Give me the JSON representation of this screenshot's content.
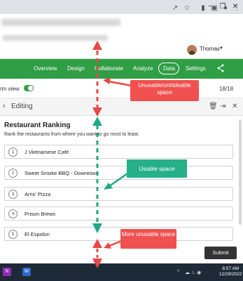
{
  "profile": {
    "name": "Thomas"
  },
  "nav": {
    "items": [
      "Overview",
      "Design",
      "Collaborate",
      "Analyze",
      "Data",
      "Settings"
    ],
    "active": "Data"
  },
  "form": {
    "view_label": "rm view",
    "count": "18/18"
  },
  "editing": {
    "title": "Editing"
  },
  "question": {
    "title": "Restaurant Ranking",
    "description": "Rank the restaurants from where you want to go most to least.",
    "items": [
      {
        "rank": "1",
        "label": "J Vietnamese Café"
      },
      {
        "rank": "2",
        "label": "Sweet Smoke BBQ - Downtown"
      },
      {
        "rank": "3",
        "label": "Arris' Pizza"
      },
      {
        "rank": "4",
        "label": "Prison Brews"
      },
      {
        "rank": "5",
        "label": "El Espolon"
      }
    ]
  },
  "footer": {
    "submit_label": "Submit"
  },
  "taskbar": {
    "time": "8:57 AM",
    "date": "12/29/2022",
    "app1_label": "N",
    "app2_label": "W",
    "tray_caret": "^"
  },
  "annotations": {
    "unusable_top": "Unusable/unhideable space",
    "usable": "Usable space",
    "unusable_bottom": "More unusable space"
  },
  "colors": {
    "brand_green": "#2f9e44",
    "annotation_red": "#f05050",
    "annotation_teal": "#26b08a",
    "arrow_red": "#e94747",
    "arrow_teal": "#20a884"
  },
  "icons": [
    "share-icon",
    "trash-icon",
    "collapse-icon",
    "close-icon",
    "back-chevron-icon",
    "bookmark-icon",
    "star-icon",
    "extension-icon",
    "menu-kebab-icon"
  ]
}
